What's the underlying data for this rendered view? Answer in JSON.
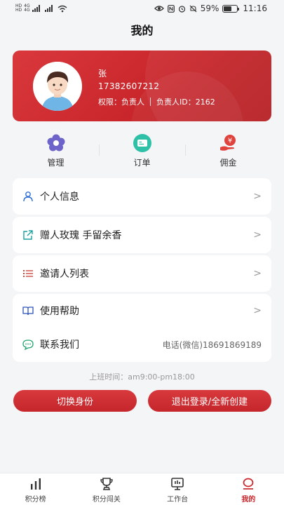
{
  "status_bar": {
    "hd1": "HD",
    "sig1": "4G",
    "hd2": "HD",
    "sig2": "4G",
    "battery": "59%",
    "battery_level": 0.59,
    "time": "11:16"
  },
  "page_title": "我的",
  "profile": {
    "name": "张",
    "phone": "17382607212",
    "permission": "权限：负责人",
    "owner_id": "负责人ID：2162"
  },
  "quick_menu": [
    {
      "label": "管理",
      "icon": "flower-icon",
      "color": "#6e63c9"
    },
    {
      "label": "订单",
      "icon": "ticket-icon",
      "color": "#2fc0a8"
    },
    {
      "label": "佣金",
      "icon": "yuan-hand-icon",
      "color": "#e0433d"
    }
  ],
  "menu": {
    "personal_info": "个人信息",
    "gift_roses": "赠人玫瑰 手留余香",
    "invitee_list": "邀请人列表",
    "help": "使用帮助",
    "contact_us": "联系我们",
    "contact_value": "电话(微信)18691869189",
    "arrow": ">"
  },
  "work_hours": "上班时间：am9:00-pm18:00",
  "buttons": {
    "switch_identity": "切换身份",
    "logout": "退出登录/全新创建"
  },
  "tab_bar": [
    {
      "label": "积分榜",
      "icon": "bar-chart-icon"
    },
    {
      "label": "积分闯关",
      "icon": "trophy-icon"
    },
    {
      "label": "工作台",
      "icon": "workbench-icon"
    },
    {
      "label": "我的",
      "icon": "profile-icon",
      "active": true
    }
  ],
  "colors": {
    "accent": "#c8262b",
    "background": "#f4f5f7"
  }
}
